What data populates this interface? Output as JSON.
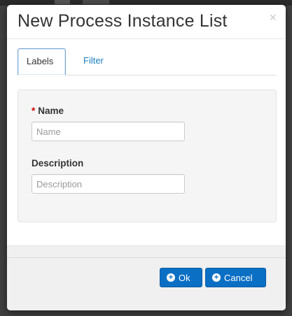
{
  "modal": {
    "title": "New Process Instance List",
    "close_glyph": "×"
  },
  "tabs": [
    {
      "label": "Labels",
      "active": true
    },
    {
      "label": "Filter",
      "active": false
    }
  ],
  "form": {
    "name": {
      "required_mark": "*",
      "label": "Name",
      "value": "",
      "placeholder": "Name"
    },
    "description": {
      "label": "Description",
      "value": "",
      "placeholder": "Description"
    }
  },
  "footer": {
    "ok_label": "Ok",
    "cancel_label": "Cancel",
    "ok_icon": "plus-circle-icon",
    "cancel_icon": "plus-circle-icon"
  },
  "colors": {
    "primary": "#0b6fc4",
    "link": "#1a7fbf",
    "required": "#cc0000"
  }
}
